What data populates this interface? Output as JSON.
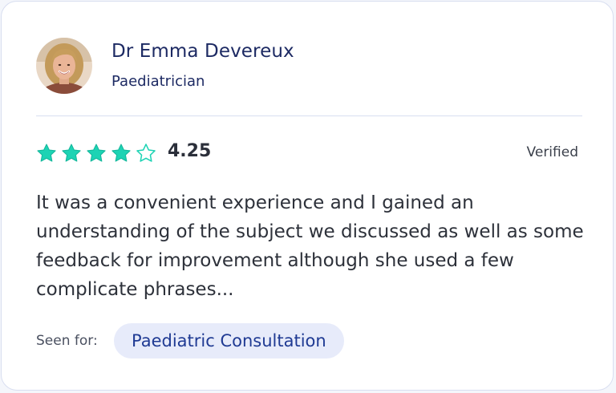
{
  "doctor": {
    "name": "Dr Emma Devereux",
    "role": "Paediatrician",
    "avatar_icon": "doctor-portrait"
  },
  "rating": {
    "value": "4.25",
    "stars_filled": 4,
    "stars_total": 5,
    "star_color": "#1dd3b4",
    "verified_label": "Verified"
  },
  "review": {
    "text": "It was a convenient experience and I gained an understanding of the subject we discussed as well as some feedback for improvement although she used a few complicate phrases..."
  },
  "seen_for": {
    "label": "Seen for:",
    "tag": "Paediatric Consultation",
    "tag_color": "#1f3a93",
    "tag_background": "#e7ebfa"
  }
}
